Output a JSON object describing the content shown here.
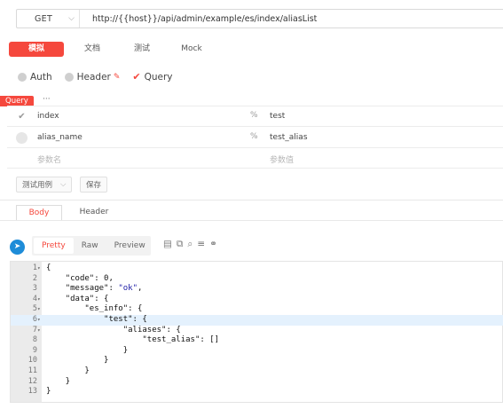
{
  "request": {
    "method": "GET",
    "url": "http://{{host}}/api/admin/example/es/index/aliasList"
  },
  "top_tabs": [
    "模拟",
    "文档",
    "测试",
    "Mock"
  ],
  "param_types": {
    "auth": "Auth",
    "header": "Header",
    "query": "Query"
  },
  "query_badge": "Query",
  "more": "···",
  "params": [
    {
      "key": "index",
      "value": "test",
      "checked": true
    },
    {
      "key": "alias_name",
      "value": "test_alias",
      "checked": false
    }
  ],
  "param_placeholder": {
    "key": "参数名",
    "value": "参数值"
  },
  "buttons": {
    "test_case": "测试用例",
    "save": "保存"
  },
  "response_tabs": [
    "Body",
    "Header"
  ],
  "view_tabs": [
    "Pretty",
    "Raw",
    "Preview"
  ],
  "code_lines": [
    {
      "n": "1",
      "fold": true,
      "text": "{"
    },
    {
      "n": "2",
      "fold": false,
      "text": "    \"code\": 0,"
    },
    {
      "n": "3",
      "fold": false,
      "text": "    \"message\": \"ok\","
    },
    {
      "n": "4",
      "fold": true,
      "text": "    \"data\": {"
    },
    {
      "n": "5",
      "fold": true,
      "text": "        \"es_info\": {"
    },
    {
      "n": "6",
      "fold": true,
      "text": "            \"test\": {"
    },
    {
      "n": "7",
      "fold": true,
      "text": "                \"aliases\": {"
    },
    {
      "n": "8",
      "fold": false,
      "text": "                    \"test_alias\": []"
    },
    {
      "n": "9",
      "fold": false,
      "text": "                }"
    },
    {
      "n": "10",
      "fold": false,
      "text": "            }"
    },
    {
      "n": "11",
      "fold": false,
      "text": "        }"
    },
    {
      "n": "12",
      "fold": false,
      "text": "    }"
    },
    {
      "n": "13",
      "fold": false,
      "text": "}"
    }
  ],
  "highlighted_line": "6",
  "colors": {
    "accent": "#f5483d",
    "send": "#1e8cd8",
    "string": "#1a1aa6"
  }
}
